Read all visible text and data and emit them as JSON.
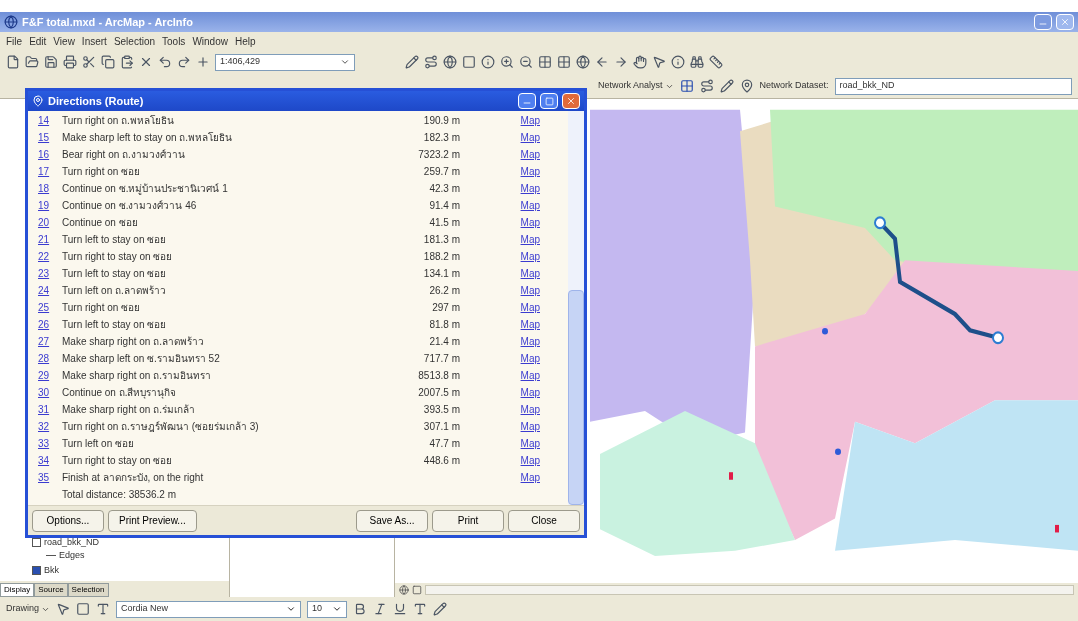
{
  "window": {
    "title": "F&F total.mxd - ArcMap - ArcInfo"
  },
  "menu": [
    "File",
    "Edit",
    "View",
    "Insert",
    "Selection",
    "Tools",
    "Window",
    "Help"
  ],
  "standard_toolbar": {
    "scale": "1:406,429"
  },
  "network_toolbar": {
    "menu": "Network Analyst",
    "dataset_label": "Network Dataset:",
    "dataset": "road_bkk_ND"
  },
  "table_of_contents": {
    "items": [
      {
        "label": "road_bkk_ND",
        "checked": false,
        "children": [
          {
            "label": "Edges"
          }
        ]
      },
      {
        "label": "Bkk",
        "checked": true
      }
    ],
    "tabs": [
      {
        "label": "Display",
        "selected": true
      },
      {
        "label": "Source",
        "selected": false
      },
      {
        "label": "Selection",
        "selected": false
      }
    ]
  },
  "directions": {
    "title": "Directions (Route)",
    "steps": [
      {
        "number": "14",
        "text": "Turn right on ถ.พหลโยธิน",
        "distance": "190.9 m",
        "link": "Map"
      },
      {
        "number": "15",
        "text": "Make sharp left to stay on ถ.พหลโยธิน",
        "distance": "182.3 m",
        "link": "Map"
      },
      {
        "number": "16",
        "text": "Bear right on ถ.งามวงศ์วาน",
        "distance": "7323.2 m",
        "link": "Map"
      },
      {
        "number": "17",
        "text": "Turn right on ซอย",
        "distance": "259.7 m",
        "link": "Map"
      },
      {
        "number": "18",
        "text": "Continue on ซ.หมู่บ้านประชานิเวศน์ 1",
        "distance": "42.3 m",
        "link": "Map"
      },
      {
        "number": "19",
        "text": "Continue on ซ.งามวงศ์วาน 46",
        "distance": "91.4 m",
        "link": "Map"
      },
      {
        "number": "20",
        "text": "Continue on ซอย",
        "distance": "41.5 m",
        "link": "Map"
      },
      {
        "number": "21",
        "text": "Turn left to stay on ซอย",
        "distance": "181.3 m",
        "link": "Map"
      },
      {
        "number": "22",
        "text": "Turn right to stay on ซอย",
        "distance": "188.2 m",
        "link": "Map"
      },
      {
        "number": "23",
        "text": "Turn left to stay on ซอย",
        "distance": "134.1 m",
        "link": "Map"
      },
      {
        "number": "24",
        "text": "Turn left on ถ.ลาดพร้าว",
        "distance": "26.2 m",
        "link": "Map"
      },
      {
        "number": "25",
        "text": "Turn right on ซอย",
        "distance": "297 m",
        "link": "Map"
      },
      {
        "number": "26",
        "text": "Turn left to stay on ซอย",
        "distance": "81.8 m",
        "link": "Map"
      },
      {
        "number": "27",
        "text": "Make sharp right on ถ.ลาดพร้าว",
        "distance": "21.4 m",
        "link": "Map"
      },
      {
        "number": "28",
        "text": "Make sharp left on ซ.รามอินทรา 52",
        "distance": "717.7 m",
        "link": "Map"
      },
      {
        "number": "29",
        "text": "Make sharp right on ถ.รามอินทรา",
        "distance": "8513.8 m",
        "link": "Map"
      },
      {
        "number": "30",
        "text": "Continue on ถ.สีหบุรานุกิจ",
        "distance": "2007.5 m",
        "link": "Map"
      },
      {
        "number": "31",
        "text": "Make sharp right on ถ.ร่มเกล้า",
        "distance": "393.5 m",
        "link": "Map"
      },
      {
        "number": "32",
        "text": "Turn right on ถ.ราษฎร์พัฒนา (ซอยร่มเกล้า 3)",
        "distance": "307.1 m",
        "link": "Map"
      },
      {
        "number": "33",
        "text": "Turn left on ซอย",
        "distance": "47.7 m",
        "link": "Map"
      },
      {
        "number": "34",
        "text": "Turn right to stay on ซอย",
        "distance": "448.6 m",
        "link": "Map"
      },
      {
        "number": "35",
        "text": "Finish at ลาดกระบัง, on the right",
        "link": "Map"
      }
    ],
    "total": "Total distance: 38536.2 m",
    "buttons": [
      "Options...",
      "Print Preview...",
      "Save As...",
      "Print",
      "Close"
    ]
  },
  "drawing_toolbar": {
    "menu": "Drawing",
    "font": "Cordia New",
    "size": "10"
  }
}
